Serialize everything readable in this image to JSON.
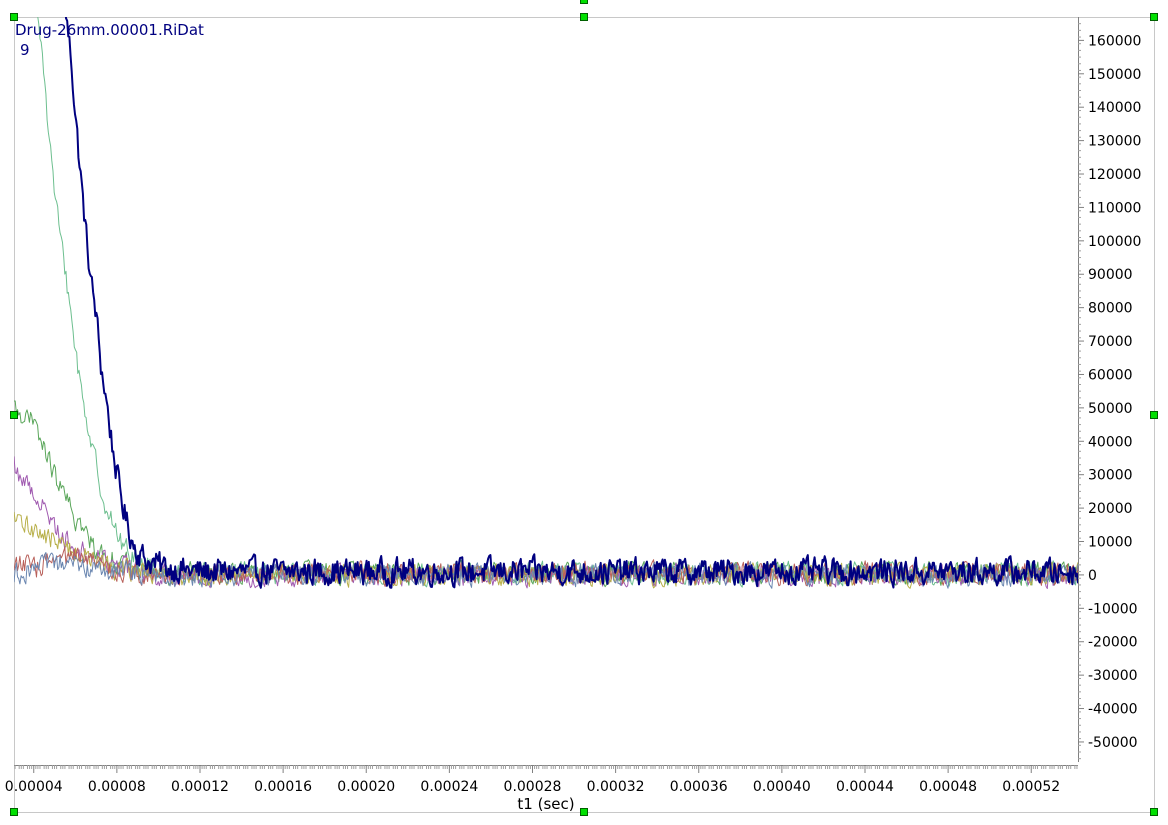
{
  "chart_data": {
    "type": "line",
    "dataset_label": "Drug-26mm.00001.RiDat",
    "trace_index_label": "9",
    "xlabel": "t1 (sec)",
    "ylabel": "",
    "xlim": [
      3.05e-05,
      0.0005425
    ],
    "ylim": [
      -56000,
      167000
    ],
    "x_ticks": [
      4e-05,
      8e-05,
      0.00012,
      0.00016,
      0.0002,
      0.00024,
      0.00028,
      0.00032,
      0.00036,
      0.0004,
      0.00044,
      0.00048,
      0.00052
    ],
    "x_tick_labels": [
      "0.00004",
      "0.00008",
      "0.00012",
      "0.00016",
      "0.00020",
      "0.00024",
      "0.00028",
      "0.00032",
      "0.00036",
      "0.00040",
      "0.00044",
      "0.00048",
      "0.00052"
    ],
    "y_ticks": [
      160000,
      150000,
      140000,
      130000,
      120000,
      110000,
      100000,
      90000,
      80000,
      70000,
      60000,
      50000,
      40000,
      30000,
      20000,
      10000,
      0,
      -10000,
      -20000,
      -30000,
      -40000,
      -50000
    ],
    "y_tick_labels": [
      "160000",
      "150000",
      "140000",
      "130000",
      "120000",
      "110000",
      "100000",
      "90000",
      "80000",
      "70000",
      "60000",
      "50000",
      "40000",
      "30000",
      "20000",
      "10000",
      "0",
      "-10000",
      "-20000",
      "-30000",
      "-40000",
      "-50000"
    ],
    "series": [
      {
        "color": "#000080",
        "width": 2,
        "points": [
          [
            5.5e-05,
            172000
          ],
          [
            5.6e-05,
            165000
          ],
          [
            5.8e-05,
            155000
          ],
          [
            6e-05,
            138000
          ],
          [
            6.25e-05,
            120000
          ],
          [
            6.5e-05,
            103000
          ],
          [
            6.75e-05,
            88000
          ],
          [
            7e-05,
            78000
          ],
          [
            7.25e-05,
            62000
          ],
          [
            7.5e-05,
            52000
          ],
          [
            7.75e-05,
            40000
          ],
          [
            8e-05,
            30000
          ],
          [
            8.25e-05,
            22000
          ],
          [
            8.5e-05,
            15000
          ],
          [
            8.75e-05,
            10000
          ],
          [
            9e-05,
            7000
          ],
          [
            9.5e-05,
            4000
          ],
          [
            0.000105,
            2000
          ],
          [
            0.00012,
            1000
          ]
        ],
        "noise_amplitude": 5500
      },
      {
        "color": "#6dbf8f",
        "width": 1,
        "points": [
          [
            3.05e-05,
            230000
          ],
          [
            4e-05,
            178000
          ],
          [
            4.25e-05,
            168000
          ],
          [
            4.5e-05,
            150000
          ],
          [
            4.75e-05,
            130000
          ],
          [
            5e-05,
            115000
          ],
          [
            5.25e-05,
            102000
          ],
          [
            5.5e-05,
            92000
          ],
          [
            5.75e-05,
            80000
          ],
          [
            6e-05,
            68000
          ],
          [
            6.25e-05,
            57000
          ],
          [
            6.5e-05,
            48000
          ],
          [
            6.75e-05,
            40000
          ],
          [
            7e-05,
            33000
          ],
          [
            7.25e-05,
            26000
          ],
          [
            7.5e-05,
            20000
          ],
          [
            8e-05,
            12000
          ],
          [
            8.5e-05,
            7000
          ],
          [
            9e-05,
            4000
          ],
          [
            0.0001,
            2000
          ],
          [
            0.00011,
            500
          ]
        ],
        "noise_amplitude": 4500
      },
      {
        "color": "#5aa65a",
        "width": 1,
        "points": [
          [
            3.05e-05,
            50000
          ],
          [
            3.5e-05,
            48000
          ],
          [
            4e-05,
            45000
          ],
          [
            4.5e-05,
            38000
          ],
          [
            5e-05,
            30000
          ],
          [
            5.5e-05,
            23000
          ],
          [
            6e-05,
            17000
          ],
          [
            6.5e-05,
            12000
          ],
          [
            7e-05,
            8000
          ],
          [
            8e-05,
            4000
          ],
          [
            9e-05,
            2000
          ],
          [
            0.0001,
            500
          ]
        ],
        "noise_amplitude": 4500
      },
      {
        "color": "#a05ab0",
        "width": 1,
        "points": [
          [
            3.05e-05,
            33000
          ],
          [
            3.5e-05,
            28000
          ],
          [
            4e-05,
            25000
          ],
          [
            4.5e-05,
            20000
          ],
          [
            5e-05,
            15000
          ],
          [
            5.5e-05,
            11000
          ],
          [
            6e-05,
            8000
          ],
          [
            7e-05,
            5000
          ],
          [
            8e-05,
            3000
          ],
          [
            9e-05,
            1000
          ],
          [
            0.0001,
            0
          ]
        ],
        "noise_amplitude": 4500
      },
      {
        "color": "#b8b04a",
        "width": 1,
        "points": [
          [
            3.05e-05,
            16000
          ],
          [
            4e-05,
            14000
          ],
          [
            5e-05,
            10000
          ],
          [
            6e-05,
            7000
          ],
          [
            7e-05,
            4000
          ],
          [
            8e-05,
            2000
          ],
          [
            9e-05,
            1000
          ],
          [
            0.0001,
            0
          ]
        ],
        "noise_amplitude": 4500
      },
      {
        "color": "#b8605a",
        "width": 1,
        "points": [
          [
            3.05e-05,
            4000
          ],
          [
            4e-05,
            2000
          ],
          [
            5e-05,
            4000
          ],
          [
            6e-05,
            5000
          ],
          [
            7e-05,
            3000
          ],
          [
            8e-05,
            1500
          ],
          [
            9e-05,
            500
          ]
        ],
        "noise_amplitude": 4500
      },
      {
        "color": "#6a86b0",
        "width": 1,
        "points": [
          [
            3.05e-05,
            0
          ],
          [
            4e-05,
            2000
          ],
          [
            5e-05,
            3000
          ],
          [
            6e-05,
            3000
          ],
          [
            7e-05,
            2000
          ],
          [
            8e-05,
            1000
          ],
          [
            9e-05,
            0
          ]
        ],
        "noise_amplitude": 4500
      }
    ],
    "grid": false,
    "legend": "top-left"
  },
  "colors": {
    "frame": "#c8c8c8",
    "handle_fill": "#00e000",
    "handle_stroke": "#006000"
  }
}
